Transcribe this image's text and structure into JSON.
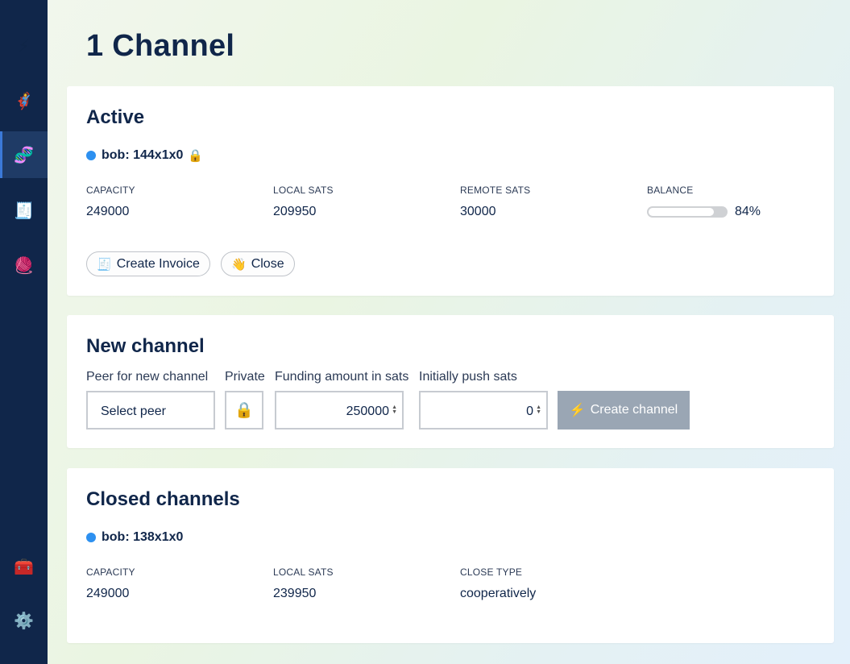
{
  "sidebar": {
    "items": [
      {
        "icon": "⚡",
        "name": "lightning-icon"
      },
      {
        "icon": "🦸",
        "name": "superhero-icon"
      },
      {
        "icon": "🧬",
        "name": "dna-icon"
      },
      {
        "icon": "🧾",
        "name": "receipt-icon"
      },
      {
        "icon": "🧶",
        "name": "yarn-icon"
      },
      {
        "icon": "🧰",
        "name": "toolbox-icon"
      },
      {
        "icon": "⚙️",
        "name": "gear-icon"
      }
    ]
  },
  "page": {
    "title": "1 Channel"
  },
  "active": {
    "heading": "Active",
    "channel_name": "bob: 144x1x0",
    "lock_icon": "🔒",
    "capacity_label": "CAPACITY",
    "capacity_value": "249000",
    "local_label": "LOCAL SATS",
    "local_value": "209950",
    "remote_label": "REMOTE SATS",
    "remote_value": "30000",
    "balance_label": "BALANCE",
    "balance_percent": 84,
    "balance_text": "84%",
    "create_invoice_icon": "🧾",
    "create_invoice_label": "Create Invoice",
    "close_icon": "👋",
    "close_label": "Close"
  },
  "new_channel": {
    "heading": "New channel",
    "peer_label": "Peer for new channel",
    "peer_value": "Select peer",
    "private_label": "Private",
    "private_icon": "🔒",
    "funding_label": "Funding amount in sats",
    "funding_value": "250000",
    "push_label": "Initially push sats",
    "push_value": "0",
    "create_icon": "⚡",
    "create_label": "Create channel"
  },
  "closed": {
    "heading": "Closed channels",
    "channel_name": "bob: 138x1x0",
    "capacity_label": "CAPACITY",
    "capacity_value": "249000",
    "local_label": "LOCAL SATS",
    "local_value": "239950",
    "close_type_label": "CLOSE TYPE",
    "close_type_value": "cooperatively"
  },
  "colors": {
    "sidebar": "#10264a",
    "status_dot": "#2d90f0",
    "button_disabled": "#9aa6b4"
  }
}
